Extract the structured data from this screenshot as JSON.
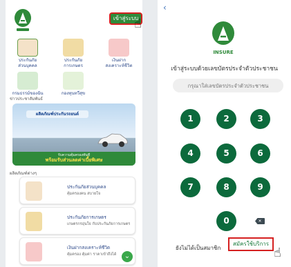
{
  "left_screen": {
    "logo_icon": "insure-logo-icon",
    "login_button": "เข้าสู่ระบบ",
    "menu_items": [
      {
        "label_line1": "ประกันภัย",
        "label_line2": "ส่วนบุคคล",
        "icon": "personal-insurance-icon"
      },
      {
        "label_line1": "ประกันภัย",
        "label_line2": "การเกษตร",
        "icon": "agri-insurance-icon"
      },
      {
        "label_line1": "เงินฝาก",
        "label_line2": "สงเคราะห์ชีวิต",
        "icon": "life-deposit-icon"
      },
      {
        "label_line1": "กรมธรรม์ของฉัน",
        "label_line2": "",
        "icon": "my-policy-icon"
      },
      {
        "label_line1": "กองทุนทวีสุข",
        "label_line2": "",
        "icon": "fund-icon"
      }
    ],
    "news_section_title": "ข่าวประชาสัมพันธ์",
    "banner": {
      "headline": "ผลิตภัณฑ์ประกันรถยนต์",
      "bottom_text": "รับความคุ้มครองทันที",
      "bottom_highlight": "พร้อมรับส่วนลดค่าเบี้ยพิเศษ"
    },
    "products_section_title": "ผลิตภัณฑ์ต่างๆ",
    "products": [
      {
        "title": "ประกันภัยส่วนบุคคล",
        "subtitle": "คุ้มครองคน สบายใจ"
      },
      {
        "title": "ประกันภัยการเกษตร",
        "subtitle": "เกษตรกรอุ่นใจ กับประกันภัยการเกษตร"
      },
      {
        "title": "เงินฝากสงเคราะห์ชีวิต",
        "subtitle": "คุ้มครอง คุ้มค่า ราคาเข้าถึงได้"
      }
    ],
    "fab_icon": "chevron-down-icon"
  },
  "right_screen": {
    "back_icon": "back-arrow-icon",
    "logo_text": "INSURE",
    "title": "เข้าสู่ระบบด้วยเลขบัตรประจำตัวประชาชน",
    "id_placeholder": "กรุณาใส่เลขบัตรประจำตัวประชาชน",
    "keypad": [
      "1",
      "2",
      "3",
      "4",
      "5",
      "6",
      "7",
      "8",
      "9",
      "0"
    ],
    "delete_icon": "backspace-icon",
    "not_member_text": "ยังไม่ได้เป็นสมาชิก",
    "register_button": "สมัครใช้บริการ"
  },
  "colors": {
    "brand_green": "#2f8a3a",
    "keypad_green": "#0c6a3c",
    "highlight_red": "#d52020"
  }
}
